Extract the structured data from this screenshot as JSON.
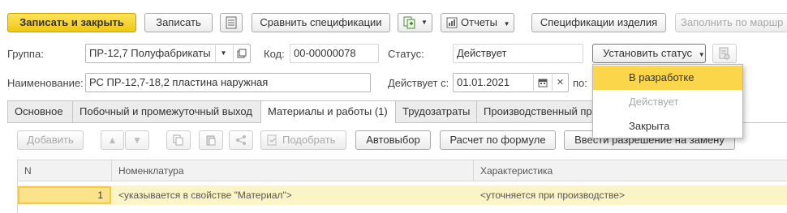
{
  "toolbar": {
    "save_close_label": "Записать и закрыть",
    "save_label": "Записать",
    "compare_specs_label": "Сравнить спецификации",
    "reports_label": "Отчеты",
    "product_specs_label": "Спецификации изделия",
    "fill_route_label": "Заполнить по маршр"
  },
  "form": {
    "group_label": "Группа:",
    "group_value": "ПР-12,7 Полуфабрикаты",
    "code_label": "Код:",
    "code_value": "00-00000078",
    "status_label": "Статус:",
    "status_value": "Действует",
    "set_status_label": "Установить статус",
    "name_label": "Наименование:",
    "name_value": "РС ПР-12,7-18,2 пластина наружная",
    "valid_from_label": "Действует с:",
    "valid_from_value": "01.01.2021",
    "to_label": "по:"
  },
  "tabs": [
    {
      "label": "Основное"
    },
    {
      "label": "Побочный и промежуточный выход"
    },
    {
      "label": "Материалы и работы (1)"
    },
    {
      "label": "Трудозатраты"
    },
    {
      "label": "Производственный пр"
    }
  ],
  "tab_toolbar": {
    "add_label": "Добавить",
    "pick_label": "Подобрать",
    "auto_select_label": "Автовыбор",
    "formula_calc_label": "Расчет по формуле",
    "replacement_label": "Ввести разрешение на замену"
  },
  "grid": {
    "columns": [
      "N",
      "Номенклатура",
      "Характеристика"
    ],
    "rows": [
      {
        "n": "1",
        "nomenclature": "<указывается в свойстве \"Материал\">",
        "characteristic": "<уточняется при производстве>"
      }
    ]
  },
  "status_dropdown": {
    "items": [
      "В разработке",
      "Действует",
      "Закрыта"
    ],
    "highlighted_index": 0,
    "disabled_index": 1
  },
  "colors": {
    "primary_button": "#f5d327",
    "highlight": "#fbd54a",
    "row_selected": "#fbf4c6"
  }
}
